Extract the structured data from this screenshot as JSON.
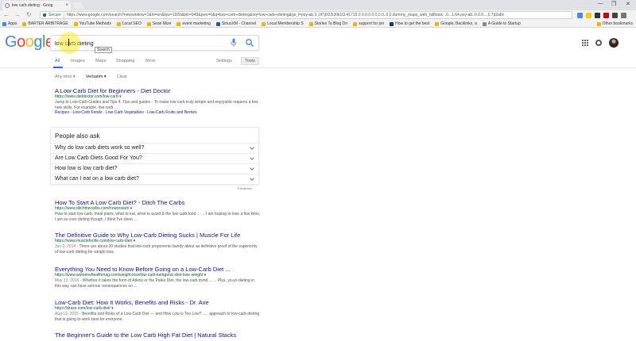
{
  "browser": {
    "tab_title": "low carb dieting - Goog",
    "tab_close": "×",
    "window_controls": [
      "—",
      "❐",
      "✕"
    ],
    "nav": {
      "back": "←",
      "forward": "→",
      "reload": "↻"
    },
    "secure_label": "Secure",
    "url": "https://www.google.com/search?newwindow=1&hl=en&biw=1920&bih=949&pws=0&q=low+carb+dieting&oq=low+carb+dieting&gs_l=psy-ab.3..0l7j0i22i30k1l3.41715.0.0.0.0.0.0.0.0..0.0.dummy_maps_web_fallback...0...1.64.psy-ab..0.0.0....0.7d2a8c",
    "extension_colors": [
      "#4a8af4",
      "#ffcc00",
      "#333333",
      "#cc0000",
      "#444444",
      "#777777"
    ],
    "bookmarks": [
      {
        "label": "Apps",
        "color": "#4285f4"
      },
      {
        "label": "BARTER ARBITRAGE",
        "color": "#f4b400"
      },
      {
        "label": "YouTube Methods",
        "color": "#f4b400"
      },
      {
        "label": "Local SEO",
        "color": "#f4b400"
      },
      {
        "label": "Sean Mize",
        "color": "#f4b400"
      },
      {
        "label": "event marketing",
        "color": "#f4b400"
      },
      {
        "label": "SiriusXM - Channel",
        "color": "#1e5aa8"
      },
      {
        "label": "Local Membership S",
        "color": "#f4b400"
      },
      {
        "label": "Stories To Blog On",
        "color": "#f4b400"
      },
      {
        "label": "support for jon",
        "color": "#f4b400"
      },
      {
        "label": "How to get the best",
        "color": "#0a3d62"
      },
      {
        "label": "Google, Backlinks, a",
        "color": "#f4b400"
      },
      {
        "label": "A Guide to Startup",
        "color": "#888888"
      }
    ],
    "other_bookmarks": "Other bookmarks"
  },
  "google": {
    "logo_letters": [
      {
        "ch": "G",
        "color": "#4285f4"
      },
      {
        "ch": "o",
        "color": "#ea4335"
      },
      {
        "ch": "o",
        "color": "#fbbc05"
      },
      {
        "ch": "g",
        "color": "#4285f4"
      },
      {
        "ch": "l",
        "color": "#34a853"
      },
      {
        "ch": "e",
        "color": "#ea4335"
      }
    ],
    "search_value": "low carb dieting",
    "tooltip": "Search",
    "tabs": [
      "All",
      "Images",
      "Maps",
      "Shopping",
      "More"
    ],
    "settings": "Settings",
    "tools": "Tools",
    "filters": {
      "time": "Any time ▾",
      "verbatim": "Verbatim ▾",
      "clear": "Clear"
    }
  },
  "results": [
    {
      "title": "A Low-Carb Diet for Beginners - Diet Doctor",
      "url": "https://www.dietdoctor.com/low-carb ▾",
      "snippet": "Jump to Low-Carb Guides and Tips 4. Tips and guides · To make low carb truly simple and enjoyable requires a few new skills. For example, low carb ...",
      "links": "Recipes · Low-Carb Foods · Low-Carb Vegetables · Low-Carb Fruits and Berries"
    },
    {
      "title": "How To Start A Low Carb Diet? - Ditch The Carbs",
      "url": "https://www.ditchthecarbs.com/howtostart/ ▾",
      "snippet": "How to start low carb, meal plans, what to eat, what to avoid & the low carb food ... ... I am hoping to lose a few kilos, I am so over dieting though, I think I've done ..."
    },
    {
      "title": "The Definitive Guide to Why Low-Carb Dieting Sucks | Muscle For Life",
      "url": "https://www.muscleforlife.com/low-carb-diet/ ▾",
      "date": "Jun 2, 2014 - ",
      "snippet": "There are about 20 studies that low-carb proponents bandy about as definitive proof of the superiority of low-carb dieting for weight loss."
    },
    {
      "title": "Everything You Need to Know Before Going on a Low-Carb Diet ...",
      "url": "https://www.womenshealthmag.com/weight-loss/low-carb-ketogenic-diet-lose-weight ▾",
      "date": "May 13, 2016 - ",
      "snippet": "Whether it takes the form of Atkins or the Paleo Diet, the low-carb trend ... ... Plus, yo-yo dieting in this way can have serious consequences on ..."
    },
    {
      "title": "Low-Carb Diet: How It Works, Benefits and Risks - Dr. Axe",
      "url": "https://draxe.com/low-carb-diet/ ▾",
      "date": "Aug 12, 2015 - ",
      "snippet": "Benefits and Risks of a Low-Carb Diet — and How Low is Too Low? ..... approach to low-carb dieting that is going to work best for everyone."
    },
    {
      "title": "The Beginner's Guide to the Low Carb High Fat Diet | Natural Stacks",
      "url": ""
    }
  ],
  "people_also_ask": {
    "title": "People also ask",
    "questions": [
      "Why do low carb diets work so well?",
      "Are Low Carb Diets Good For You?",
      "How low is low carb diet?",
      "What can I eat on a low carb diet?"
    ],
    "feedback": "Feedback"
  }
}
